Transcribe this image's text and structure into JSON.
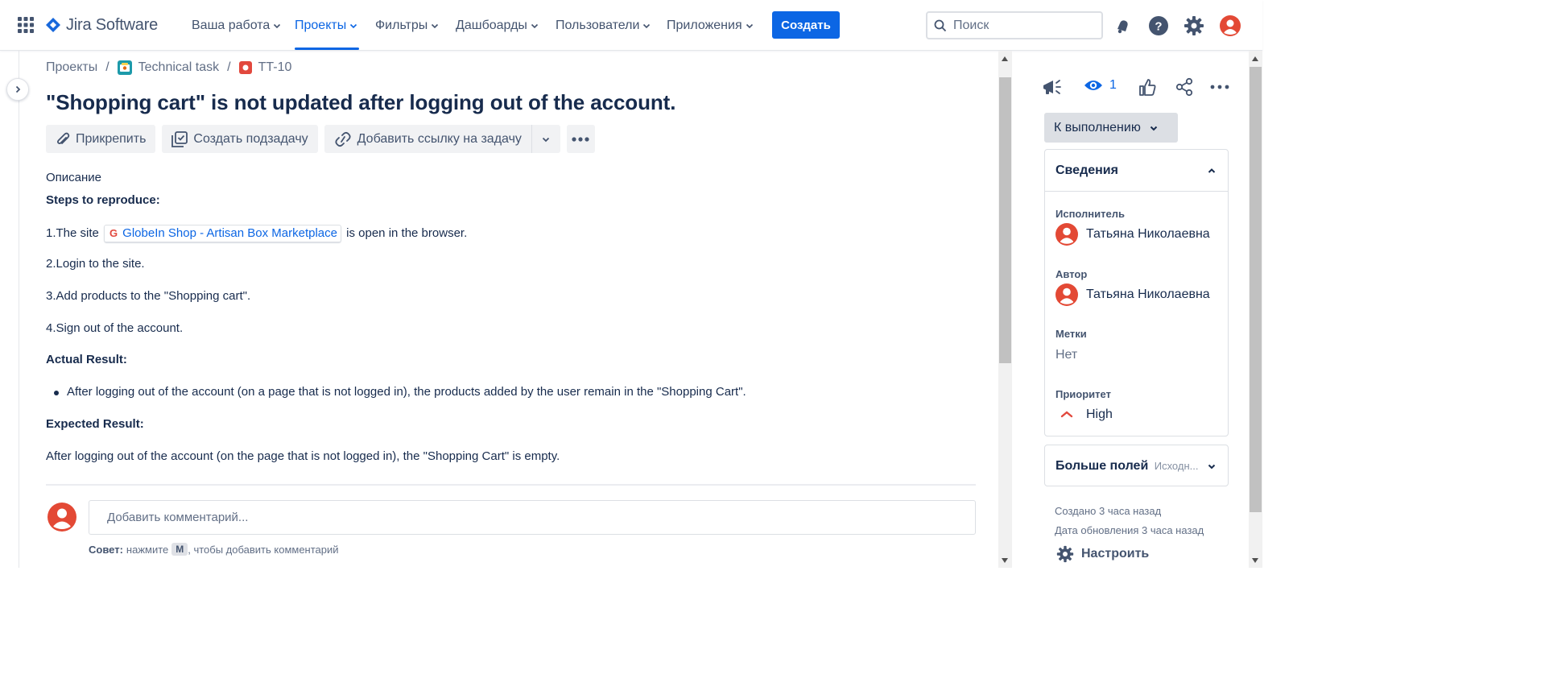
{
  "header": {
    "logo_text": "Jira Software",
    "nav": [
      {
        "label": "Ваша работа"
      },
      {
        "label": "Проекты"
      },
      {
        "label": "Фильтры"
      },
      {
        "label": "Дашбоарды"
      },
      {
        "label": "Пользователи"
      },
      {
        "label": "Приложения"
      }
    ],
    "active_nav": "Проекты",
    "create_label": "Создать",
    "search_placeholder": "Поиск",
    "brand_color": "#0c66e4",
    "icons": [
      "app-switcher-icon",
      "notifications-icon",
      "help-icon",
      "settings-icon",
      "profile-avatar"
    ]
  },
  "breadcrumb": {
    "root": "Проекты",
    "project": "Technical task",
    "issue_key": "TT-10"
  },
  "issue": {
    "title": "\"Shopping cart\" is not updated after logging out of the account.",
    "actions": {
      "attach": "Прикрепить",
      "subtask": "Создать подзадачу",
      "link": "Добавить ссылку на задачу"
    },
    "description_label": "Описание",
    "description": {
      "steps_heading": "Steps to reproduce:",
      "step1_prefix": "1.The site",
      "step1_link": "GlobeIn Shop - Artisan Box Marketplace",
      "step1_suffix": "is open in the browser.",
      "step2": "2.Login to the site.",
      "step3": "3.Add products to the \"Shopping cart\".",
      "step4": "4.Sign out of the account.",
      "actual_heading": "Actual Result:",
      "actual_item": "After logging out of the account (on a page that is not logged in), the products added by the user remain in the \"Shopping Cart\".",
      "expected_heading": "Expected Result:",
      "expected_text": "After logging out of the account (on the page that is not logged in), the \"Shopping Cart\" is empty."
    },
    "comment": {
      "placeholder": "Добавить комментарий...",
      "tip_label": "Совет:",
      "tip_prefix": "нажмите",
      "tip_key": "M",
      "tip_suffix": ", чтобы добавить комментарий"
    }
  },
  "sidebar": {
    "watch_count": "1",
    "status": "К выполнению",
    "details_title": "Сведения",
    "fields": {
      "assignee_label": "Исполнитель",
      "assignee": "Татьяна Николаевна",
      "reporter_label": "Автор",
      "reporter": "Татьяна Николаевна",
      "labels_label": "Метки",
      "labels_value": "Нет",
      "priority_label": "Приоритет",
      "priority_value": "High"
    },
    "more_fields": "Больше полей",
    "more_fields_hint": "Исходн...",
    "created": "Создано 3 часа назад",
    "updated": "Дата обновления 3 часа назад",
    "configure": "Настроить"
  }
}
